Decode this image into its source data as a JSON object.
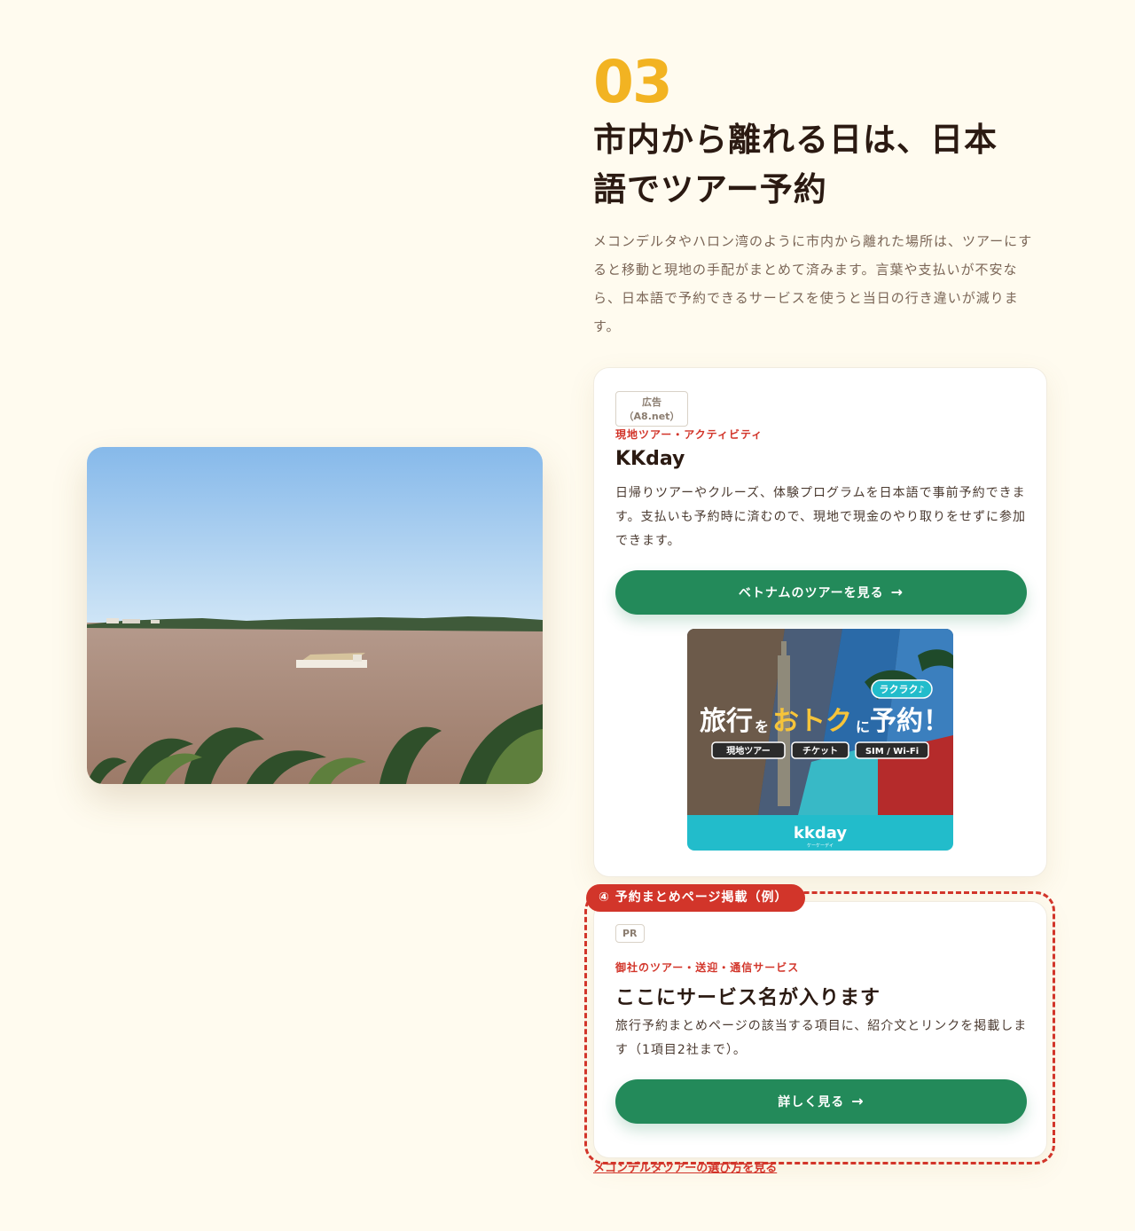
{
  "section": {
    "number": "03",
    "heading_line1": "市内から離れる日は、日本",
    "heading_line2": "語でツアー予約",
    "lead": "メコンデルタやハロン湾のように市内から離れた場所は、ツアーにすると移動と現地の手配がまとめて済みます。言葉や支払いが不安なら、日本語で予約できるサービスを使うと当日の行き違いが減ります。"
  },
  "ad_card": {
    "badge": "広告（A8.net）",
    "category": "現地ツアー・アクティビティ",
    "title": "KKday",
    "description": "日帰りツアーやクルーズ、体験プログラムを日本語で事前予約できます。支払いも予約時に済むので、現地で現金のやり取りをせずに参加できます。",
    "button_label": "ベトナムのツアーを見る",
    "button_arrow": "→",
    "banner": {
      "bubble": "ラクラク♪",
      "headline_a": "旅行",
      "headline_b": "を",
      "headline_c": "おトク",
      "headline_d": "に",
      "headline_e": "予約！",
      "pills": [
        "現地ツアー",
        "チケット",
        "SIM / Wi-Fi"
      ],
      "logo": "kkday",
      "logo_sub": "ケーケーデイ"
    }
  },
  "example_card": {
    "label": "④ 予約まとめページ掲載（例）",
    "badge": "PR",
    "category": "御社のツアー・送迎・通信サービス",
    "title": "ここにサービス名が入ります",
    "description": "旅行予約まとめページの該当する項目に、紹介文とリンクを掲載します（1項目2社まで）。",
    "button_label": "詳しく見る",
    "button_arrow": "→"
  },
  "bottom_link": "メコンデルタツアーの選び方を見る",
  "colors": {
    "accent_yellow": "#f2b322",
    "green": "#238a5a",
    "red": "#d2352a",
    "background": "#fffbef"
  }
}
